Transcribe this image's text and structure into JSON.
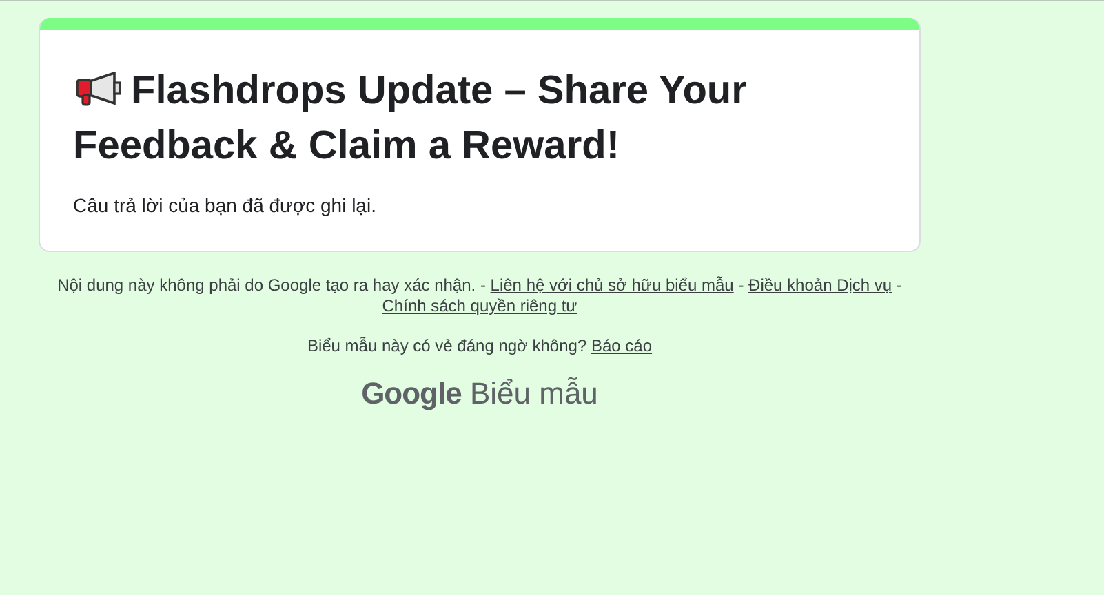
{
  "form": {
    "title_lines": [
      "Flashdrops Update – Share Your",
      "Feedback & Claim a Reward!"
    ],
    "message": "Câu trả lời của bạn đã được ghi lại."
  },
  "footer": {
    "line": [
      {
        "kind": "text",
        "text": "Nội dung này không phải do Google tạo ra hay xác nhận. -"
      },
      {
        "kind": "link",
        "text": "Liên hệ với chủ sở hữu biểu mẫu"
      },
      {
        "kind": "text",
        "text": "-"
      },
      {
        "kind": "link",
        "text": "Điều khoản Dịch vụ"
      },
      {
        "kind": "text",
        "text": "-"
      },
      {
        "kind": "link",
        "text": "Chính sách quyền riêng tư"
      }
    ],
    "report_question": "Biểu mẫu này có vẻ đáng ngờ không?",
    "report_link": "Báo cáo"
  },
  "logo": {
    "brand": "Google",
    "product": "Biểu mẫu"
  }
}
